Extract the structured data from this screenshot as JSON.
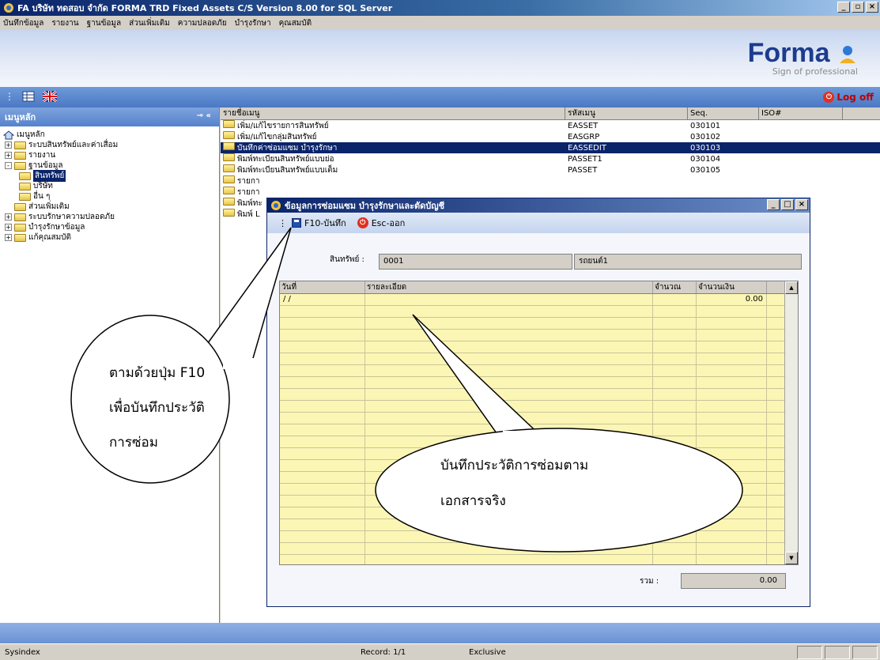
{
  "window": {
    "title": "FA บริษัท ทดสอบ จำกัด FORMA TRD Fixed Assets C/S Version 8.00 for SQL Server"
  },
  "menu": [
    "บันทึกข้อมูล",
    "รายงาน",
    "ฐานข้อมูล",
    "ส่วนเพิ่มเติม",
    "ความปลอดภัย",
    "บำรุงรักษา",
    "คุณสมบัติ"
  ],
  "brand": {
    "name": "Forma",
    "tagline": "Sign of professional"
  },
  "toolbar": {
    "logoff_label": "Log off"
  },
  "sidebar": {
    "title": "เมนูหลัก",
    "root": "เมนูหลัก",
    "items": [
      {
        "label": "ระบบสินทรัพย์และค่าเสื่อม",
        "level": 1,
        "expander": "+"
      },
      {
        "label": "รายงาน",
        "level": 1,
        "expander": "+"
      },
      {
        "label": "ฐานข้อมูล",
        "level": 1,
        "expander": "-"
      },
      {
        "label": "สินทรัพย์",
        "level": 2,
        "selected": true
      },
      {
        "label": "บริษัท",
        "level": 2
      },
      {
        "label": "อื่น ๆ",
        "level": 2
      },
      {
        "label": "ส่วนเพิ่มเติม",
        "level": 1
      },
      {
        "label": "ระบบรักษาความปลอดภัย",
        "level": 1,
        "expander": "+"
      },
      {
        "label": "บำรุงรักษาข้อมูล",
        "level": 1,
        "expander": "+"
      },
      {
        "label": "แก้คุณสมบัติ",
        "level": 1,
        "expander": "+"
      }
    ]
  },
  "menu_list": {
    "columns": [
      "รายชื่อเมนู",
      "รหัสเมนู",
      "Seq.",
      "ISO#"
    ],
    "rows": [
      {
        "name": "เพิ่ม/แก้ไขรายการสินทรัพย์",
        "code": "EASSET",
        "seq": "030101"
      },
      {
        "name": "เพิ่ม/แก้ไขกลุ่มสินทรัพย์",
        "code": "EASGRP",
        "seq": "030102"
      },
      {
        "name": "บันทึกค่าซ่อมแซม บำรุงรักษา",
        "code": "EASSEDIT",
        "seq": "030103",
        "selected": true
      },
      {
        "name": "พิมพ์ทะเบียนสินทรัพย์แบบย่อ",
        "code": "PASSET1",
        "seq": "030104"
      },
      {
        "name": "พิมพ์ทะเบียนสินทรัพย์แบบเต็ม",
        "code": "PASSET",
        "seq": "030105"
      },
      {
        "name": "รายกา",
        "code": "",
        "seq": ""
      },
      {
        "name": "รายกา",
        "code": "",
        "seq": ""
      },
      {
        "name": "พิมพ์ทะ",
        "code": "",
        "seq": ""
      },
      {
        "name": "พิมพ์ L",
        "code": "",
        "seq": ""
      }
    ]
  },
  "dialog": {
    "title": "ข้อมูลการซ่อมแซม บำรุงรักษาและตัดบัญชี",
    "save_label": "F10-บันทึก",
    "exit_label": "Esc-ออก",
    "asset_label": "สินทรัพย์ :",
    "asset_code": "0001",
    "asset_name": "รถยนต์1",
    "grid_columns": [
      "วันที่",
      "รายละเอียด",
      "จำนวณ",
      "จำนวนเงิน"
    ],
    "first_row": {
      "date": " / /",
      "amount": "0.00"
    },
    "total_label": "รวม :",
    "total_value": "0.00"
  },
  "callouts": {
    "left_line1": "ตามด้วยปุ่ม F10",
    "left_line2": "เพื่อบันทึกประวัติ",
    "left_line3": "การซ่อม",
    "right_line1": "บันทึกประวัติการซ่อมตาม",
    "right_line2": "เอกสารจริง"
  },
  "status": {
    "left": "Sysindex",
    "record": "Record: 1/1",
    "mode": "Exclusive"
  }
}
